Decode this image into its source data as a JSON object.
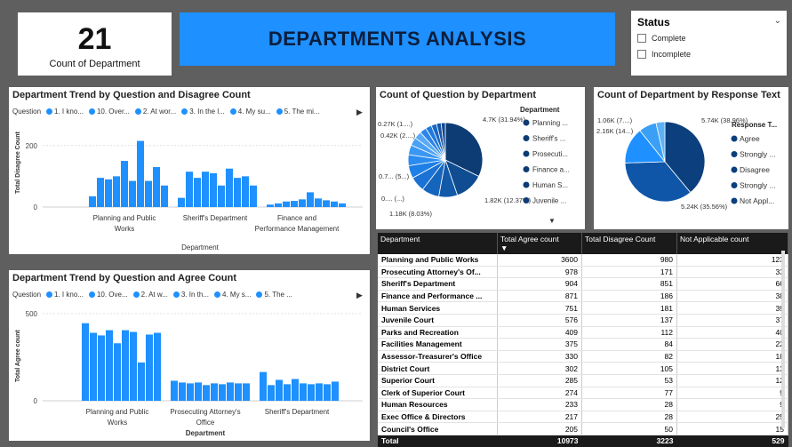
{
  "kpi": {
    "value": "21",
    "label": "Count of Department"
  },
  "banner": {
    "title": "DEPARTMENTS ANALYSIS"
  },
  "status_slicer": {
    "title": "Status",
    "options": [
      "Complete",
      "Incomplete"
    ]
  },
  "question_legend": {
    "lead": "Question",
    "items": [
      "1. I kno...",
      "10. Over...",
      "2. At wor...",
      "3. In the l...",
      "4. My su...",
      "5. The mi..."
    ]
  },
  "question_legend_agree": {
    "lead": "Question",
    "items": [
      "1. I kno...",
      "10. Ove...",
      "2. At w...",
      "3. In th...",
      "4. My s...",
      "5. The ..."
    ]
  },
  "chart_data": [
    {
      "type": "bar",
      "title": "Department Trend by Question and Disagree Count",
      "xlabel": "Department",
      "ylabel": "Total Disagree Count",
      "yticks": [
        "200",
        "0"
      ],
      "ylim": [
        0,
        260
      ],
      "categories": [
        "Planning and Public Works",
        "Sheriff's Department",
        "Finance and Performance Management"
      ],
      "series_values": [
        [
          35,
          95,
          90,
          100,
          150,
          85,
          215,
          85,
          130,
          70
        ],
        [
          30,
          115,
          95,
          115,
          110,
          70,
          125,
          95,
          100,
          70
        ],
        [
          8,
          12,
          18,
          20,
          25,
          48,
          28,
          22,
          18,
          12
        ]
      ]
    },
    {
      "type": "pie",
      "title": "Count of Question by Department",
      "legend_title": "Department",
      "legend": [
        "Planning ...",
        "Sheriff's ...",
        "Prosecuti...",
        "Finance a...",
        "Human S...",
        "Juvenile ..."
      ],
      "slices": [
        31.94,
        12.37,
        8.03,
        7.5,
        6.5,
        5.5,
        4.7,
        4.2,
        3.5,
        3.2,
        2.9,
        2.6,
        2.3,
        2.0,
        1.8
      ],
      "labels": [
        "4.7K (31.94%)",
        "1.82K (12.37%)",
        "1.18K (8.03%)",
        "0.... (...)",
        "0.7... (5...)",
        "0.42K (2....)",
        "0.27K (1....)"
      ]
    },
    {
      "type": "pie",
      "title": "Count of Department by Response Text",
      "legend_title": "Response T...",
      "legend": [
        "Agree",
        "Strongly ...",
        "Disagree",
        "Strongly ...",
        "Not Appl..."
      ],
      "slices": [
        38.96,
        35.56,
        14.7,
        7.2,
        3.58
      ],
      "labels": [
        "5.74K (38.96%)",
        "5.24K (35.56%)",
        "2.16K (14...)",
        "1.06K (7....)"
      ]
    },
    {
      "type": "bar",
      "title": "Department Trend by Question and Agree Count",
      "xlabel": "Department",
      "ylabel": "Total Agree count",
      "yticks": [
        "500",
        "0"
      ],
      "ylim": [
        0,
        520
      ],
      "categories": [
        "Planning and Public Works",
        "Prosecuting Attorney's Office",
        "Sheriff's Department"
      ],
      "series_values": [
        [
          445,
          390,
          375,
          405,
          330,
          405,
          395,
          220,
          380,
          390
        ],
        [
          115,
          105,
          100,
          105,
          90,
          100,
          95,
          105,
          100,
          100
        ],
        [
          165,
          90,
          120,
          95,
          125,
          100,
          95,
          100,
          95,
          110
        ]
      ]
    }
  ],
  "table": {
    "columns": [
      "Department",
      "Total Agree count",
      "Total Disagree Count",
      "Not Applicable count"
    ],
    "rows": [
      [
        "Planning and Public Works",
        "3600",
        "980",
        "123"
      ],
      [
        "Prosecuting Attorney's Of...",
        "978",
        "171",
        "33"
      ],
      [
        "Sheriff's Department",
        "904",
        "851",
        "66"
      ],
      [
        "Finance and Performance ...",
        "871",
        "186",
        "38"
      ],
      [
        "Human Services",
        "751",
        "181",
        "39"
      ],
      [
        "Juvenile Court",
        "576",
        "137",
        "37"
      ],
      [
        "Parks and Recreation",
        "409",
        "112",
        "40"
      ],
      [
        "Facilities Management",
        "375",
        "84",
        "22"
      ],
      [
        "Assessor-Treasurer's Office",
        "330",
        "82",
        "18"
      ],
      [
        "District Court",
        "302",
        "105",
        "13"
      ],
      [
        "Superior Court",
        "285",
        "53",
        "12"
      ],
      [
        "Clerk of Superior Court",
        "274",
        "77",
        "9"
      ],
      [
        "Human Resources",
        "233",
        "28",
        "9"
      ],
      [
        "Exec Office & Directors",
        "217",
        "28",
        "25"
      ],
      [
        "Council's Office",
        "205",
        "50",
        "15"
      ]
    ],
    "total": [
      "Total",
      "10973",
      "3223",
      "529"
    ]
  },
  "colors": {
    "accent": "#1e90ff",
    "dark_navy": "#0c3e7a",
    "background": "#5f5f5f"
  }
}
